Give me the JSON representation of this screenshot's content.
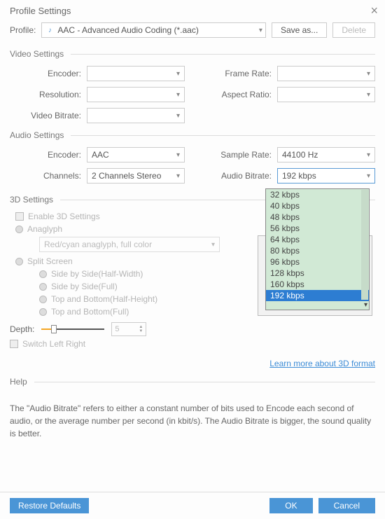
{
  "window": {
    "title": "Profile Settings",
    "close": "×"
  },
  "profile": {
    "label": "Profile:",
    "value": "AAC - Advanced Audio Coding (*.aac)",
    "save_as": "Save as...",
    "delete": "Delete"
  },
  "video": {
    "header": "Video Settings",
    "encoder_label": "Encoder:",
    "encoder_value": "",
    "resolution_label": "Resolution:",
    "resolution_value": "",
    "bitrate_label": "Video Bitrate:",
    "bitrate_value": "",
    "framerate_label": "Frame Rate:",
    "framerate_value": "",
    "aspect_label": "Aspect Ratio:",
    "aspect_value": ""
  },
  "audio": {
    "header": "Audio Settings",
    "encoder_label": "Encoder:",
    "encoder_value": "AAC",
    "channels_label": "Channels:",
    "channels_value": "2 Channels Stereo",
    "samplerate_label": "Sample Rate:",
    "samplerate_value": "44100 Hz",
    "bitrate_label": "Audio Bitrate:",
    "bitrate_value": "192 kbps",
    "bitrate_options": [
      "32 kbps",
      "40 kbps",
      "48 kbps",
      "56 kbps",
      "64 kbps",
      "80 kbps",
      "96 kbps",
      "128 kbps",
      "160 kbps",
      "192 kbps"
    ]
  },
  "threeD": {
    "header": "3D Settings",
    "enable": "Enable 3D Settings",
    "anaglyph": "Anaglyph",
    "anaglyph_mode": "Red/cyan anaglyph, full color",
    "split": "Split Screen",
    "sbs_half": "Side by Side(Half-Width)",
    "sbs_full": "Side by Side(Full)",
    "tab_half": "Top and Bottom(Half-Height)",
    "tab_full": "Top and Bottom(Full)",
    "depth_label": "Depth:",
    "depth_value": "5",
    "switch_lr": "Switch Left Right",
    "learn_more": "Learn more about 3D format"
  },
  "help": {
    "header": "Help",
    "text": "The \"Audio Bitrate\" refers to either a constant number of bits used to Encode each second of audio, or the average number per second (in kbit/s). The Audio Bitrate is bigger, the sound quality is better."
  },
  "footer": {
    "restore": "Restore Defaults",
    "ok": "OK",
    "cancel": "Cancel"
  }
}
